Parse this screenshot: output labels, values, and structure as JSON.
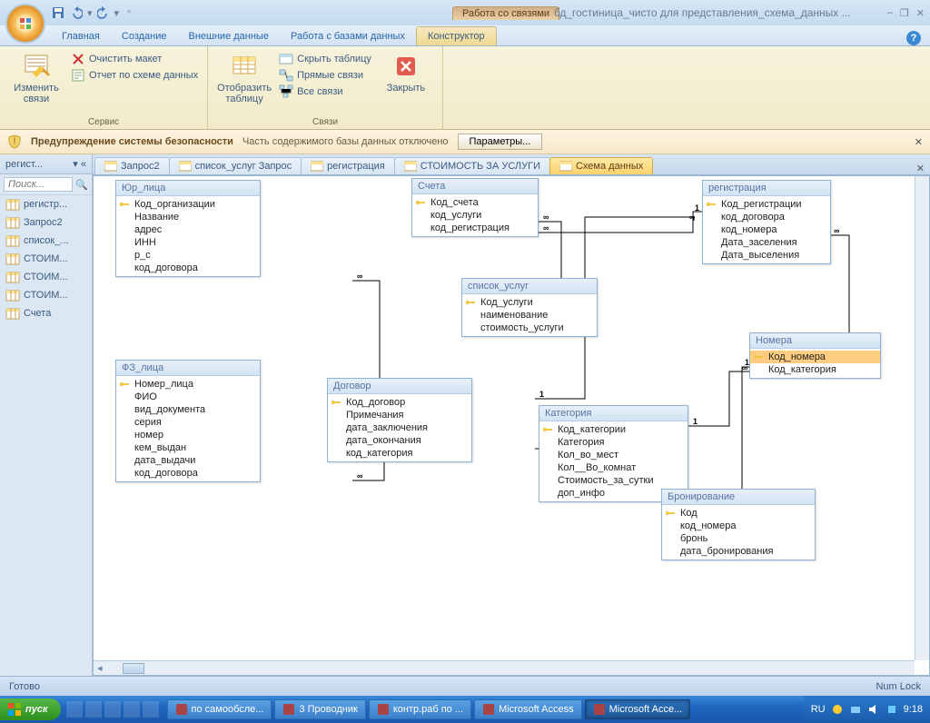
{
  "title": {
    "context": "Работа со связями",
    "doc": "бд_гостиница_чисто для представления_схема_данных ..."
  },
  "qat": {
    "save": "save-icon",
    "undo": "undo-icon",
    "redo": "redo-icon"
  },
  "tabs": [
    "Главная",
    "Создание",
    "Внешние данные",
    "Работа с базами данных",
    "Конструктор"
  ],
  "ribbon": {
    "g1": {
      "label": "Сервис",
      "big": "Изменить связи",
      "s1": "Очистить макет",
      "s2": "Отчет по схеме данных"
    },
    "g2": {
      "label": "Связи",
      "big": "Отобразить таблицу",
      "s1": "Скрыть таблицу",
      "s2": "Прямые связи",
      "s3": "Все связи",
      "close": "Закрыть"
    }
  },
  "sec": {
    "title": "Предупреждение системы безопасности",
    "msg": "Часть содержимого базы данных отключено",
    "btn": "Параметры..."
  },
  "nav": {
    "hdr": "регист...",
    "search": "Поиск...",
    "items": [
      "регистр...",
      "Запрос2",
      "список_...",
      "СТОИМ...",
      "СТОИМ...",
      "СТОИМ...",
      "Счета"
    ]
  },
  "doctabs": [
    {
      "label": "Запрос2"
    },
    {
      "label": "список_услуг Запрос"
    },
    {
      "label": "регистрация"
    },
    {
      "label": "СТОИМОСТЬ ЗА УСЛУГИ"
    },
    {
      "label": "Схема данных",
      "active": true
    }
  ],
  "tables": {
    "yur": {
      "title": "Юр_лица",
      "fields": [
        [
          "Код_организации",
          true
        ],
        [
          "Название",
          false
        ],
        [
          "адрес",
          false
        ],
        [
          "ИНН",
          false
        ],
        [
          "р_с",
          false
        ],
        [
          "код_договора",
          false
        ]
      ]
    },
    "scheta": {
      "title": "Счета",
      "fields": [
        [
          "Код_счета",
          true
        ],
        [
          "код_услуги",
          false
        ],
        [
          "код_регистрация",
          false
        ]
      ]
    },
    "reg": {
      "title": "регистрация",
      "fields": [
        [
          "Код_регистрации",
          true
        ],
        [
          "код_договора",
          false
        ],
        [
          "код_номера",
          false
        ],
        [
          "Дата_заселения",
          false
        ],
        [
          "Дата_выселения",
          false
        ]
      ]
    },
    "spisok": {
      "title": "список_услуг",
      "fields": [
        [
          "Код_услуги",
          true
        ],
        [
          "наименование",
          false
        ],
        [
          "стоимость_услуги",
          false
        ]
      ]
    },
    "nomera": {
      "title": "Номера",
      "fields": [
        [
          "Код_номера",
          true,
          "sel"
        ],
        [
          "Код_категория",
          false
        ]
      ]
    },
    "fz": {
      "title": "ФЗ_лица",
      "fields": [
        [
          "Номер_лица",
          true
        ],
        [
          "ФИО",
          false
        ],
        [
          "вид_документа",
          false
        ],
        [
          "серия",
          false
        ],
        [
          "номер",
          false
        ],
        [
          "кем_выдан",
          false
        ],
        [
          "дата_выдачи",
          false
        ],
        [
          "код_договора",
          false
        ]
      ]
    },
    "dog": {
      "title": "Договор",
      "fields": [
        [
          "Код_договор",
          true
        ],
        [
          "Примечания",
          false
        ],
        [
          "дата_заключения",
          false
        ],
        [
          "дата_окончания",
          false
        ],
        [
          "код_категория",
          false
        ]
      ]
    },
    "kat": {
      "title": "Категория",
      "fields": [
        [
          "Код_категории",
          true
        ],
        [
          "Категория",
          false
        ],
        [
          "Кол_во_мест",
          false
        ],
        [
          "Кол__Во_комнат",
          false
        ],
        [
          "Стоимость_за_сутки",
          false
        ],
        [
          "доп_инфо",
          false
        ]
      ]
    },
    "bron": {
      "title": "Бронирование",
      "fields": [
        [
          "Код",
          true
        ],
        [
          "код_номера",
          false
        ],
        [
          "бронь",
          false
        ],
        [
          "дата_бронирования",
          false
        ]
      ]
    }
  },
  "status": {
    "left": "Готово",
    "right": "Num Lock"
  },
  "taskbar": {
    "start": "пуск",
    "tasks": [
      {
        "label": "по самообсле..."
      },
      {
        "label": "3 Проводник"
      },
      {
        "label": "контр.раб по ..."
      },
      {
        "label": "Microsoft Access"
      },
      {
        "label": "Microsoft Acce...",
        "active": true
      }
    ],
    "lang": "RU",
    "clock": "9:18"
  }
}
